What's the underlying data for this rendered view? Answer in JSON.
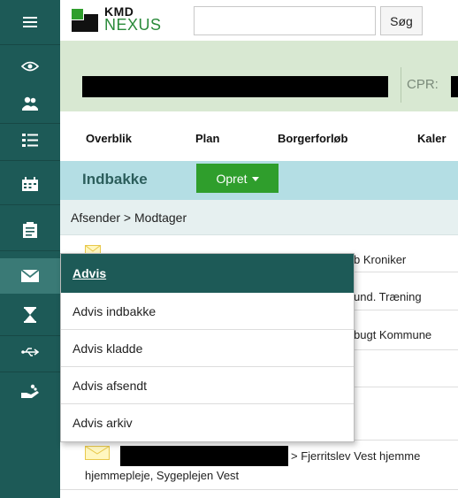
{
  "brand": {
    "logo_top": "KMD",
    "logo_bottom": "NEXUS",
    "accent_green": "#2f9e2c",
    "sidebar_teal": "#1d5a57"
  },
  "search": {
    "value": "",
    "placeholder": "",
    "button_label": "Søg"
  },
  "patient": {
    "cpr_label": "CPR:"
  },
  "tabs": [
    {
      "label": "Overblik"
    },
    {
      "label": "Plan"
    },
    {
      "label": "Borgerforløb"
    },
    {
      "label": "Kaler"
    }
  ],
  "inbox": {
    "title": "Indbakke",
    "create_label": "Opret"
  },
  "list": {
    "column_header": "Afsender > Modtager",
    "rows": [
      {
        "text": "b Kroniker"
      },
      {
        "text": "und. Træning"
      },
      {
        "text": "bugt Kommune"
      },
      {
        "text": "> Fjerritslev Vest hjemme",
        "text2": "hjemmepleje, Sygeplejen Vest"
      }
    ]
  },
  "dropdown": {
    "header": "Advis",
    "items": [
      {
        "label": "Advis indbakke"
      },
      {
        "label": "Advis kladde"
      },
      {
        "label": "Advis afsendt"
      },
      {
        "label": "Advis arkiv"
      }
    ]
  },
  "sidebar": {
    "icons": [
      "menu-icon",
      "eye-icon",
      "people-icon",
      "list-icon",
      "calendar-icon",
      "clipboard-icon",
      "mail-icon",
      "hourglass-icon",
      "usb-icon",
      "hand-icon"
    ],
    "active_icon": "mail-icon"
  }
}
